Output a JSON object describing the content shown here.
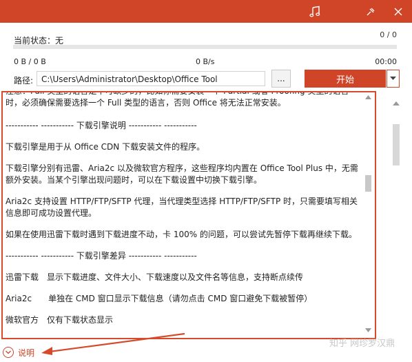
{
  "status": {
    "label": "当前状态：无",
    "count": "0 / 0",
    "progress": 0,
    "size": "0 B / 0 B",
    "speed": "0 B/s",
    "time": "00:00"
  },
  "path": {
    "label": "路径:",
    "value": "C:\\Users\\Administrator\\Desktop\\Office Tool",
    "browse_label": "..."
  },
  "start_button": {
    "label": "开始"
  },
  "help_text": "说明",
  "watermark": "知乎 网珍罗汉鼎",
  "content": {
    "p1": "注意：Full 类型的语言是不可缺少的，比如你需要安装一个 Partial 或者 Proofing 类型的语言时，必须确保需要选择一个 Full 类型的语言，否则 Office 将无法正常安装。",
    "s1": "----------- ----------- 下载引擎说明 ----------- -----------",
    "p2": "下载引擎是用于从 Office CDN 下载安装文件的程序。",
    "p3": "下载引擎分别有迅雷、Aria2c 以及微软官方程序，这些程序均内置在 Office Tool Plus 中，无需额外安装。当某个引擎出现问题时，可以在下载设置中切换下载引擎。",
    "p4": "Aria2c 支持设置 HTTP/FTP/SFTP 代理，当代理类型选择 HTTP/FTP/SFTP 时，只需要填写相关信息即可成功设置代理。",
    "p5": "如果在使用迅雷下载时遇到下载进度不动，卡 100% 的问题，可以尝试先暂停下载再继续下载。",
    "s2": "----------- ----------- 下载引擎差异 ----------- -----------",
    "r1": "迅雷下载　显示下载进度、文件大小、下载速度以及文件名等信息，支持断点续传",
    "r2": "Aria2c　　单独在 CMD 窗口显示下载信息（请勿点击 CMD 窗口避免下载被暂停）",
    "r3": "微软官方　仅有下载状态显示"
  },
  "icons": {
    "music": "music-note-icon",
    "pin": "pin-icon",
    "close": "close-icon",
    "help": "chevron-down-circle-icon"
  },
  "colors": {
    "accent": "#d04427",
    "highlight_border": "#d64a2c"
  }
}
